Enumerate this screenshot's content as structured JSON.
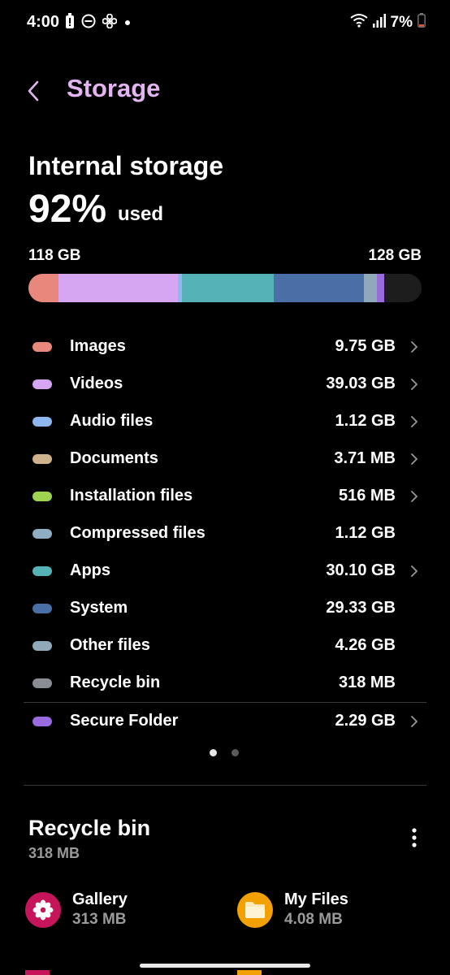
{
  "status_bar": {
    "time": "4:00",
    "battery": "7%",
    "left_icons": [
      "battery-alert-icon",
      "do-not-disturb-icon",
      "fan-icon",
      "notification-dot-icon"
    ],
    "right_icons": [
      "wifi-icon",
      "signal-icon",
      "battery-icon"
    ]
  },
  "header": {
    "title": "Storage",
    "back_icon": "back-arrow-icon"
  },
  "internal_storage": {
    "title": "Internal storage",
    "percent": "92%",
    "used_label": "used",
    "used_gb": "118 GB",
    "total_gb": "128 GB",
    "usage_fraction": 0.92
  },
  "usage_bar": [
    {
      "category": "Images",
      "fraction": 0.076,
      "color": "#e8877c"
    },
    {
      "category": "Videos",
      "fraction": 0.305,
      "color": "#d7a6f2"
    },
    {
      "category": "Audio files",
      "fraction": 0.009,
      "color": "#8eb7f0"
    },
    {
      "category": "Apps",
      "fraction": 0.235,
      "color": "#55b3b7"
    },
    {
      "category": "System",
      "fraction": 0.229,
      "color": "#4a6ea6"
    },
    {
      "category": "Other files",
      "fraction": 0.033,
      "color": "#8fa8ba"
    },
    {
      "category": "Secure Folder",
      "fraction": 0.018,
      "color": "#9a6bdc"
    }
  ],
  "categories": [
    {
      "label": "Images",
      "value": "9.75 GB",
      "color": "#e8877c",
      "chevron": true
    },
    {
      "label": "Videos",
      "value": "39.03 GB",
      "color": "#d7a6f2",
      "chevron": true
    },
    {
      "label": "Audio files",
      "value": "1.12 GB",
      "color": "#8eb7f0",
      "chevron": true
    },
    {
      "label": "Documents",
      "value": "3.71 MB",
      "color": "#cfb38c",
      "chevron": true
    },
    {
      "label": "Installation files",
      "value": "516 MB",
      "color": "#9ed44f",
      "chevron": true
    },
    {
      "label": "Compressed files",
      "value": "1.12 GB",
      "color": "#8faec4",
      "chevron": false
    },
    {
      "label": "Apps",
      "value": "30.10 GB",
      "color": "#55b3b7",
      "chevron": true
    },
    {
      "label": "System",
      "value": "29.33 GB",
      "color": "#4a6ea6",
      "chevron": false
    },
    {
      "label": "Other files",
      "value": "4.26 GB",
      "color": "#8fa8ba",
      "chevron": false
    },
    {
      "label": "Recycle bin",
      "value": "318 MB",
      "color": "#8a8d94",
      "chevron": false
    },
    {
      "label": "Secure Folder",
      "value": "2.29 GB",
      "color": "#9a6bdc",
      "chevron": true
    }
  ],
  "pager": {
    "pages": 2,
    "active": 0
  },
  "recycle_bin": {
    "title": "Recycle bin",
    "size": "318 MB",
    "more_icon": "more-vertical-icon",
    "apps": [
      {
        "name": "Gallery",
        "size": "313 MB",
        "icon": "gallery-flower-icon",
        "color": "#c6155b"
      },
      {
        "name": "My Files",
        "size": "4.08 MB",
        "icon": "folder-icon",
        "color": "#f2a100"
      }
    ]
  }
}
